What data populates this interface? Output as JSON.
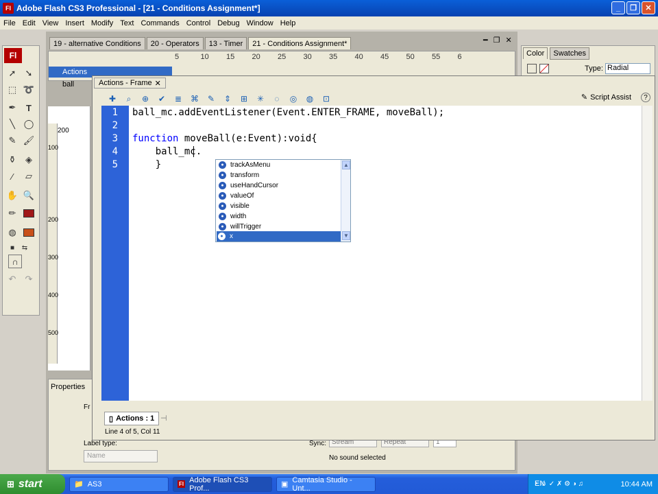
{
  "window": {
    "title": "Adobe Flash CS3 Professional - [21 - Conditions Assignment*]",
    "app_icon": "Fl"
  },
  "menu": [
    "File",
    "Edit",
    "View",
    "Insert",
    "Modify",
    "Text",
    "Commands",
    "Control",
    "Debug",
    "Window",
    "Help"
  ],
  "doc_tabs": [
    {
      "label": "19 - alternative Conditions"
    },
    {
      "label": "20 - Operators"
    },
    {
      "label": "13 - Timer"
    },
    {
      "label": "21 - Conditions Assignment*"
    }
  ],
  "timeline": {
    "frame_numbers": [
      "5",
      "10",
      "15",
      "20",
      "25",
      "30",
      "35",
      "40",
      "45",
      "50",
      "55",
      "6"
    ],
    "layers": [
      {
        "name": "Actions"
      },
      {
        "name": "ball"
      }
    ],
    "stage_ruler": "200",
    "vruler": [
      "100",
      "200",
      "300",
      "400",
      "500"
    ]
  },
  "color_panel": {
    "tabs": [
      "Color",
      "Swatches"
    ],
    "type_label": "Type:",
    "type_value": "Radial"
  },
  "actions_panel": {
    "title": "Actions - Frame",
    "script_assist": "Script Assist",
    "help": "?",
    "line_numbers": [
      "1",
      "2",
      "3",
      "4",
      "5"
    ],
    "code": {
      "l1": "ball_mc.addEventListener(Event.ENTER_FRAME, moveBall);",
      "l3_kw": "function",
      "l3_rest": " moveBall(e:Event):void{",
      "l4": "    ball_mc.",
      "l5": "    }"
    },
    "autocomplete": [
      "trackAsMenu",
      "transform",
      "useHandCursor",
      "valueOf",
      "visible",
      "width",
      "willTrigger",
      "x"
    ],
    "script_tab": "Actions : 1",
    "status": "Line 4 of 5, Col 11"
  },
  "properties": {
    "tab": "Properties",
    "frame_label": "Fr",
    "label_type": "Label type:",
    "name_placeholder": "Name",
    "sync_label": "Sync:",
    "sync_value": "Stream",
    "repeat_value": "Repeat",
    "count_value": "1",
    "sound_status": "No sound selected"
  },
  "taskbar": {
    "start": "start",
    "tasks": [
      {
        "label": "AS3"
      },
      {
        "label": "Adobe Flash CS3 Prof..."
      },
      {
        "label": "Camtasia Studio - Unt..."
      }
    ],
    "lang": "EN",
    "time": "10:44 AM"
  }
}
